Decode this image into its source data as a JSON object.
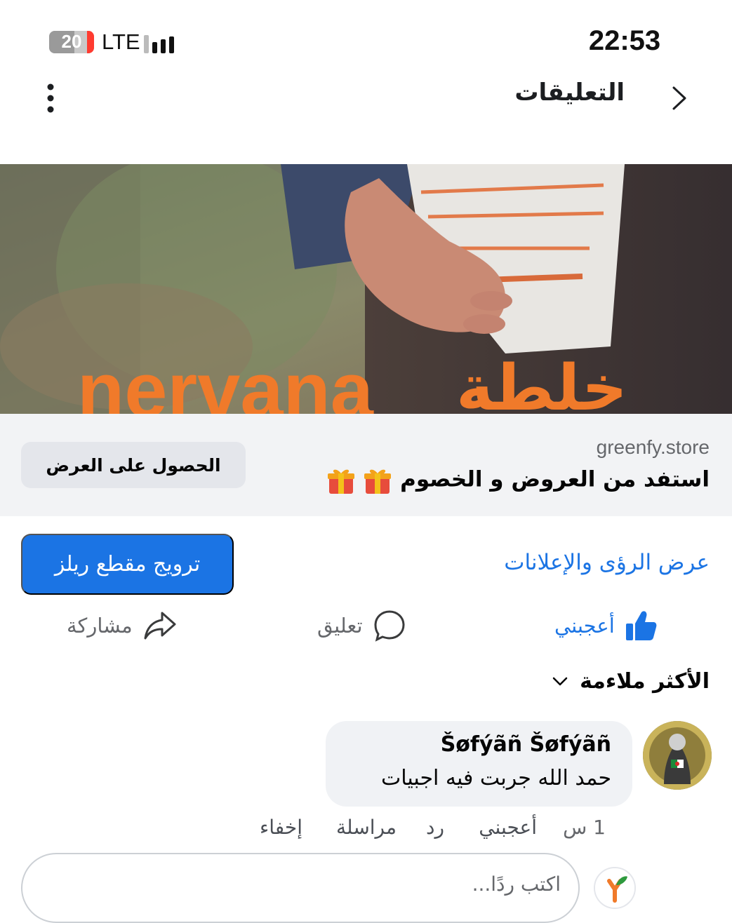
{
  "status_bar": {
    "battery": "20",
    "network": "LTE",
    "time": "22:53"
  },
  "header": {
    "title": "التعليقات"
  },
  "ad": {
    "image_text": "nervana خلطة",
    "domain": "greenfy.store",
    "headline": "استفد من العروض و الخصوم",
    "cta": "الحصول على العرض"
  },
  "actions": {
    "insights": "عرض الرؤى والإعلانات",
    "promote": "ترويج مقطع ريلز",
    "like": "أعجبني",
    "comment": "تعليق",
    "share": "مشاركة"
  },
  "sort": {
    "label": "الأكثر ملاءمة"
  },
  "comments": [
    {
      "author": "Šøfýãñ Šøfýãñ",
      "text": "حمد الله جربت فيه اجبيات",
      "time": "1 س",
      "like": "أعجبني",
      "reply": "رد",
      "message": "مراسلة",
      "hide": "إخفاء"
    }
  ],
  "reply_box": {
    "placeholder": "اكتب ردًا..."
  },
  "colors": {
    "accent": "#1b74e4",
    "secondary_text": "#65676b",
    "card_bg": "#f2f3f5"
  }
}
